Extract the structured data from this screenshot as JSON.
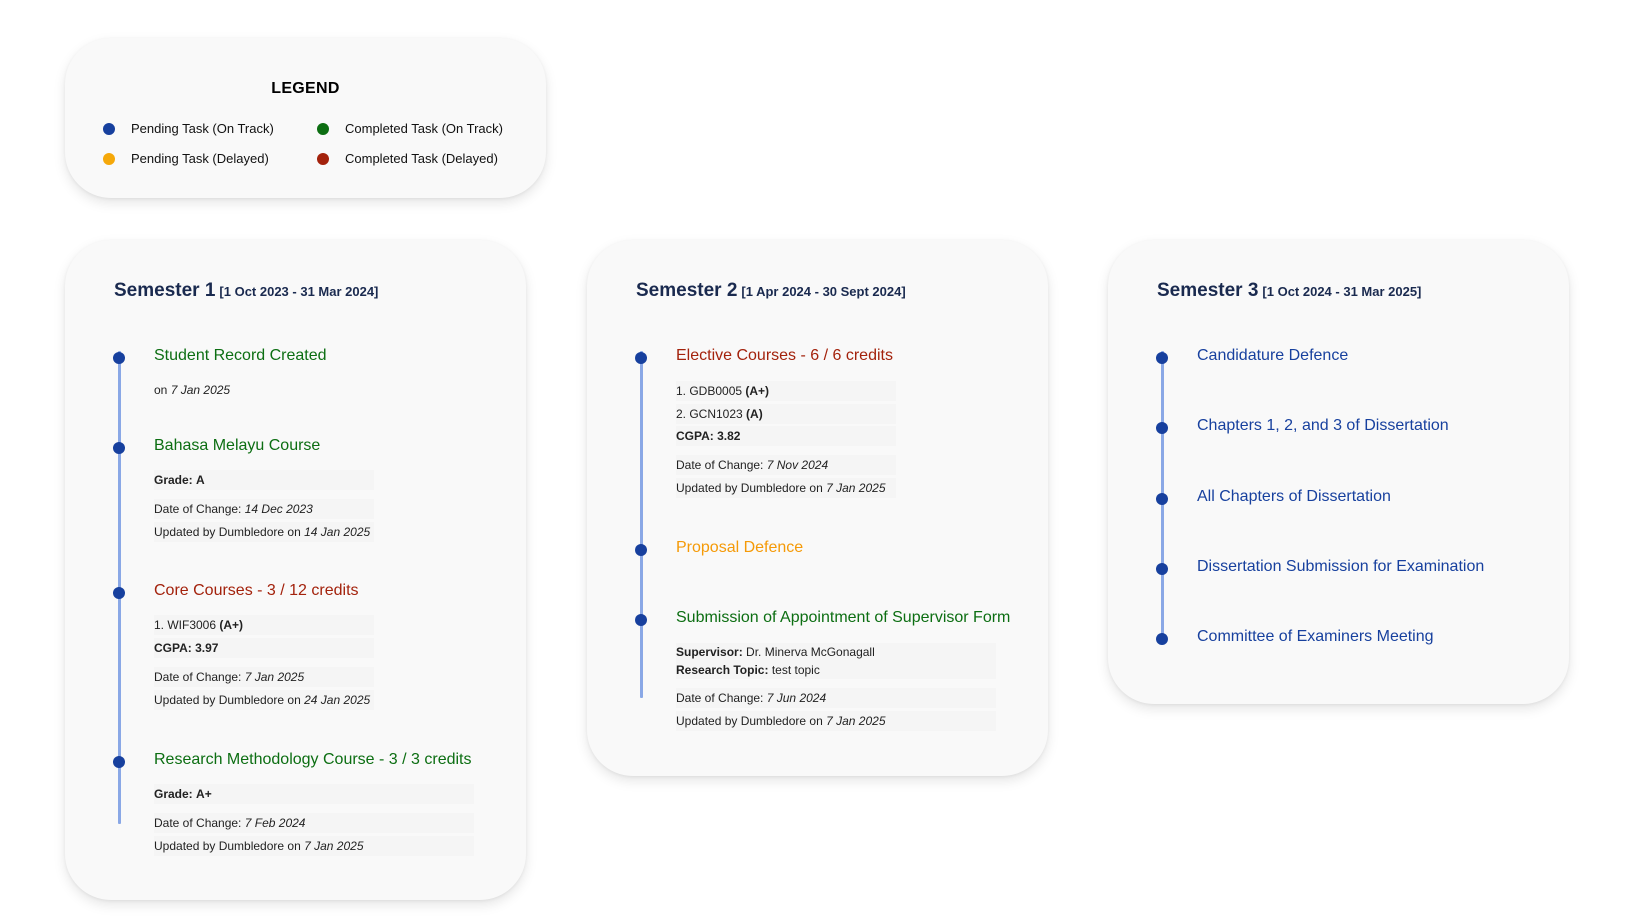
{
  "legend": {
    "title": "LEGEND",
    "items": [
      {
        "label": "Pending Task (On Track)",
        "color": "#17409e"
      },
      {
        "label": "Completed Task (On Track)",
        "color": "#0c6e12"
      },
      {
        "label": "Pending Task (Delayed)",
        "color": "#f5a80a"
      },
      {
        "label": "Completed Task (Delayed)",
        "color": "#a3220c"
      }
    ]
  },
  "semesters": [
    {
      "title": "Semester 1",
      "range": "[1 Oct 2023 - 31 Mar 2024]",
      "items": [
        {
          "title": "Student Record Created",
          "on_prefix": "on",
          "on_date": "7 Jan 2025"
        },
        {
          "title": "Bahasa Melayu Course",
          "grade_label": "Grade:",
          "grade": "A",
          "change_label": "Date of Change:",
          "change_date": "14 Dec 2023",
          "updated_prefix": "Updated by Dumbledore on",
          "updated_date": "14 Jan 2025"
        },
        {
          "title": "Core Courses - 3 / 12 credits",
          "course_1": "1. WIF3006",
          "course_1_grade": "(A+)",
          "cgpa": "CGPA: 3.97",
          "change_label": "Date of Change:",
          "change_date": "7 Jan 2025",
          "updated_prefix": "Updated by Dumbledore on",
          "updated_date": "24 Jan 2025"
        },
        {
          "title": "Research Methodology Course - 3 / 3 credits",
          "grade_label": "Grade:",
          "grade": "A+",
          "change_label": "Date of Change:",
          "change_date": "7 Feb 2024",
          "updated_prefix": "Updated by Dumbledore on",
          "updated_date": "7 Jan 2025"
        }
      ]
    },
    {
      "title": "Semester 2",
      "range": "[1 Apr 2024 - 30 Sept 2024]",
      "items": [
        {
          "title": "Elective Courses - 6 / 6 credits",
          "course_1": "1. GDB0005",
          "course_1_grade": "(A+)",
          "course_2": "2. GCN1023",
          "course_2_grade": "(A)",
          "cgpa": "CGPA: 3.82",
          "change_label": "Date of Change:",
          "change_date": "7 Nov 2024",
          "updated_prefix": "Updated by Dumbledore on",
          "updated_date": "7 Jan 2025"
        },
        {
          "title": "Proposal Defence"
        },
        {
          "title": "Submission of Appointment of Supervisor Form",
          "supervisor_label": "Supervisor:",
          "supervisor": "Dr. Minerva McGonagall",
          "topic_label": "Research Topic:",
          "topic": "test topic",
          "change_label": "Date of Change:",
          "change_date": "7 Jun 2024",
          "updated_prefix": "Updated by Dumbledore on",
          "updated_date": "7 Jan 2025"
        }
      ]
    },
    {
      "title": "Semester 3",
      "range": "[1 Oct 2024 - 31 Mar 2025]",
      "items": [
        {
          "title": "Candidature Defence"
        },
        {
          "title": "Chapters 1, 2, and 3 of Dissertation"
        },
        {
          "title": "All Chapters of Dissertation"
        },
        {
          "title": "Dissertation Submission for Examination"
        },
        {
          "title": "Committee of Examiners Meeting"
        }
      ]
    }
  ]
}
